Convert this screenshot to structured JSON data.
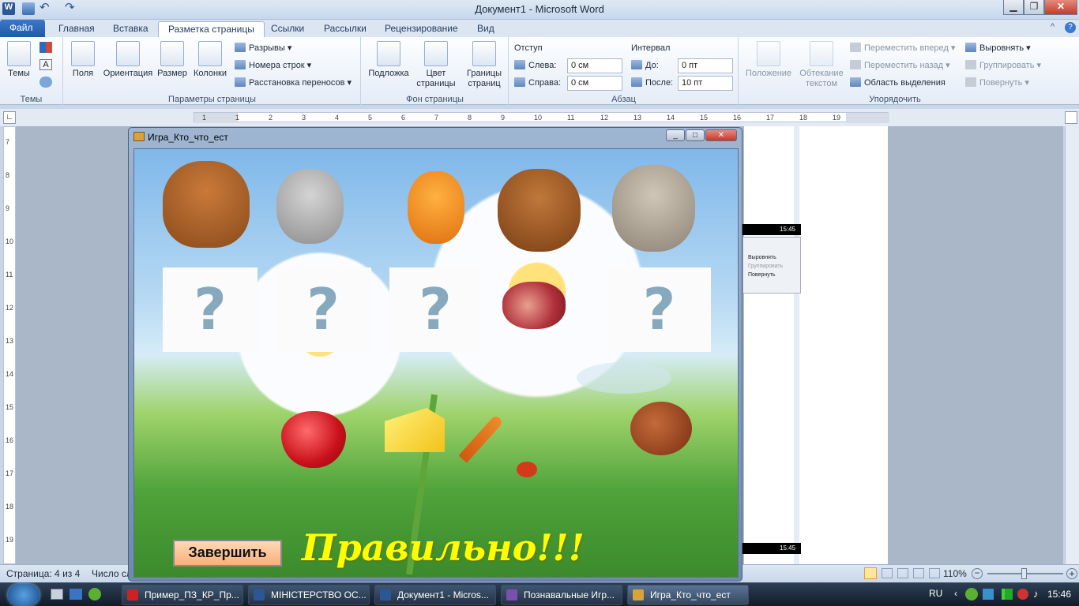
{
  "titlebar": {
    "title": "Документ1 - Microsoft Word"
  },
  "tabs": [
    "Файл",
    "Главная",
    "Вставка",
    "Разметка страницы",
    "Ссылки",
    "Рассылки",
    "Рецензирование",
    "Вид"
  ],
  "ribbon": {
    "themes": {
      "label": "Темы",
      "group": "Темы"
    },
    "page_setup": {
      "fields": "Поля",
      "orientation": "Ориентация",
      "size": "Размер",
      "columns": "Колонки",
      "breaks": "Разрывы",
      "line_numbers": "Номера строк",
      "hyphenation": "Расстановка переносов",
      "group": "Параметры страницы"
    },
    "background": {
      "watermark": "Подложка",
      "page_color": "Цвет страницы",
      "page_borders": "Границы страниц",
      "group": "Фон страницы"
    },
    "paragraph": {
      "indent": "Отступ",
      "left_label": "Слева:",
      "left_value": "0 см",
      "right_label": "Справа:",
      "right_value": "0 см",
      "spacing": "Интервал",
      "before_label": "До:",
      "before_value": "0 пт",
      "after_label": "После:",
      "after_value": "10 пт",
      "group": "Абзац"
    },
    "arrange": {
      "position": "Положение",
      "wrap": "Обтекание текстом",
      "bring_forward": "Переместить вперед",
      "send_backward": "Переместить назад",
      "selection_pane": "Область выделения",
      "align": "Выровнять",
      "group_btn": "Группировать",
      "rotate": "Повернуть",
      "group": "Упорядочить"
    }
  },
  "ruler_numbers": [
    "1",
    "1",
    "2",
    "3",
    "4",
    "5",
    "6",
    "7",
    "8",
    "9",
    "10",
    "11",
    "12",
    "13",
    "14",
    "15",
    "16",
    "17",
    "18",
    "19"
  ],
  "vruler_numbers": [
    "7",
    "8",
    "9",
    "10",
    "11",
    "12",
    "13",
    "14",
    "15",
    "16",
    "17",
    "18",
    "19"
  ],
  "thumb_times": [
    "15:45",
    "15:45"
  ],
  "thumb_menu": [
    "Выровнять",
    "Группировать",
    "Повернуть"
  ],
  "game": {
    "title": "Игра_Кто_что_ест",
    "cards": [
      "?",
      "?",
      "?",
      "?"
    ],
    "finish_button": "Завершить",
    "result": "Правильно!!!"
  },
  "status": {
    "page": "Страница: 4 из 4",
    "words": "Число сл",
    "zoom": "110%"
  },
  "taskbar": {
    "items": [
      "Пример_ПЗ_КР_Пр...",
      "МІНІСТЕРСТВО ОС...",
      "Документ1 - Micros...",
      "Познавальные Игр...",
      "Игра_Кто_что_ест"
    ],
    "lang": "RU",
    "clock": "15:46"
  }
}
